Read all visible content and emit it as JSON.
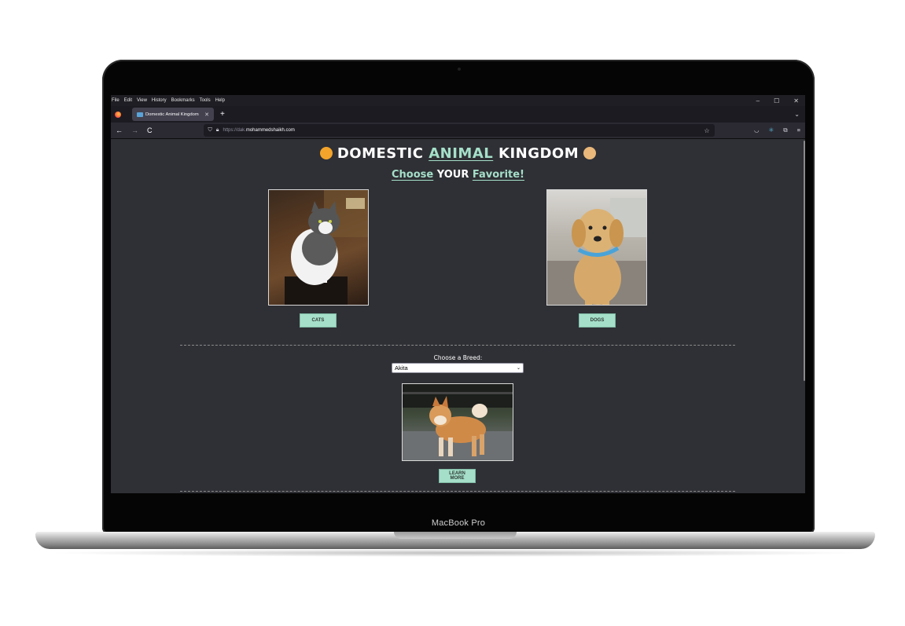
{
  "device": {
    "label": "MacBook Pro"
  },
  "menubar": {
    "items": [
      "File",
      "Edit",
      "View",
      "History",
      "Bookmarks",
      "Tools",
      "Help"
    ],
    "window_controls": [
      "–",
      "☐",
      "✕"
    ]
  },
  "tabs": [
    {
      "label": "Domestic Animal Kingdom",
      "close": "✕"
    }
  ],
  "new_tab": "+",
  "tab_overflow": "⌄",
  "nav": {
    "back": "←",
    "forward": "→",
    "reload": "C"
  },
  "url": {
    "protocol": "https://dak.",
    "domain": "mohammedshaikh.com"
  },
  "page": {
    "title_part1": "DOMESTIC ",
    "title_accent": "ANIMAL",
    "title_part2": " KINGDOM",
    "subtitle_word1": "Choose",
    "subtitle_word2": " YOUR ",
    "subtitle_word3": "Favorite!",
    "cats_button": "CATS",
    "dogs_button": "DOGS",
    "breed_label": "Choose a Breed:",
    "breed_selected": "Akita",
    "learn_more_button": "LEARN MORE"
  },
  "colors": {
    "accent": "#a5dfc9",
    "page_bg": "#2f3035",
    "chrome_bg": "#1c1b22"
  }
}
